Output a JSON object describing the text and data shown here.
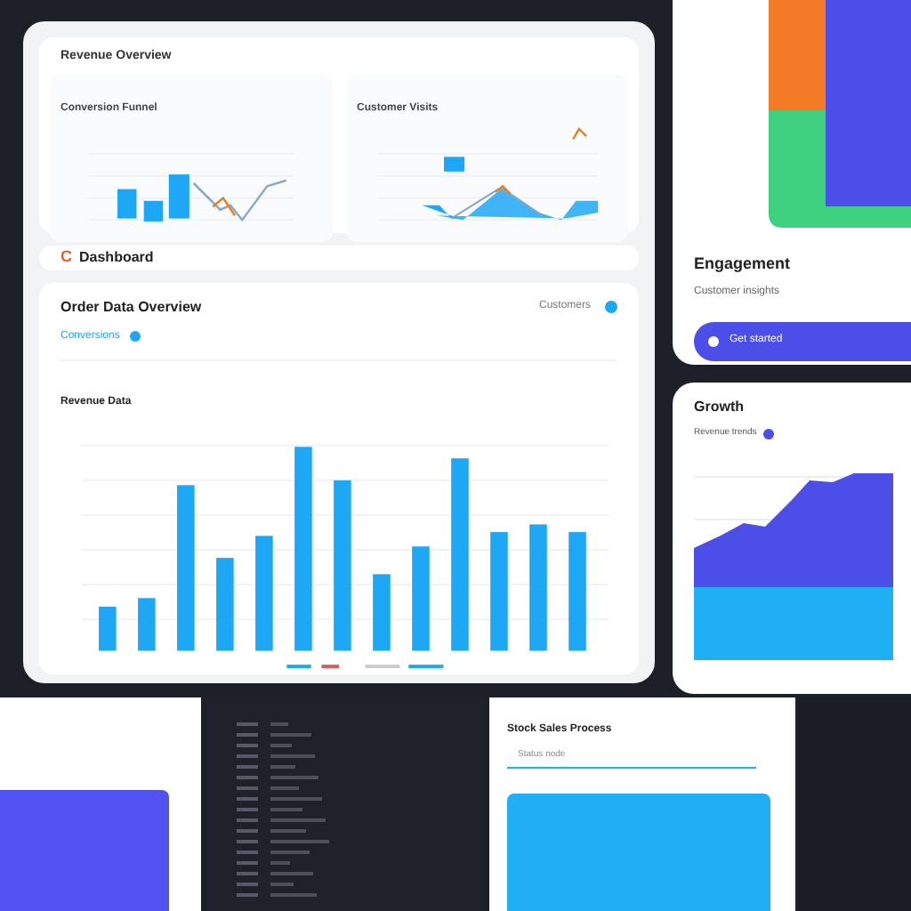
{
  "overview": {
    "title": "Revenue Overview",
    "charts": [
      {
        "title": "Conversion Funnel",
        "kind": "bars"
      },
      {
        "title": "Customer Visits",
        "kind": "line"
      }
    ]
  },
  "header": {
    "logo": "C",
    "title": "Dashboard"
  },
  "main_chart": {
    "title": "Order Data Overview",
    "filter": "Conversions",
    "filter_on": true,
    "legend_label": "Customers",
    "subtitle": "Revenue Data"
  },
  "promo": {
    "title": "Engagement",
    "subtitle": "Customer insights",
    "button": "Get started"
  },
  "growth": {
    "title": "Growth",
    "subtitle": "Revenue trends",
    "toggle_on": true
  },
  "process": {
    "title": "Stock Sales Process",
    "status": "Status node"
  }
}
